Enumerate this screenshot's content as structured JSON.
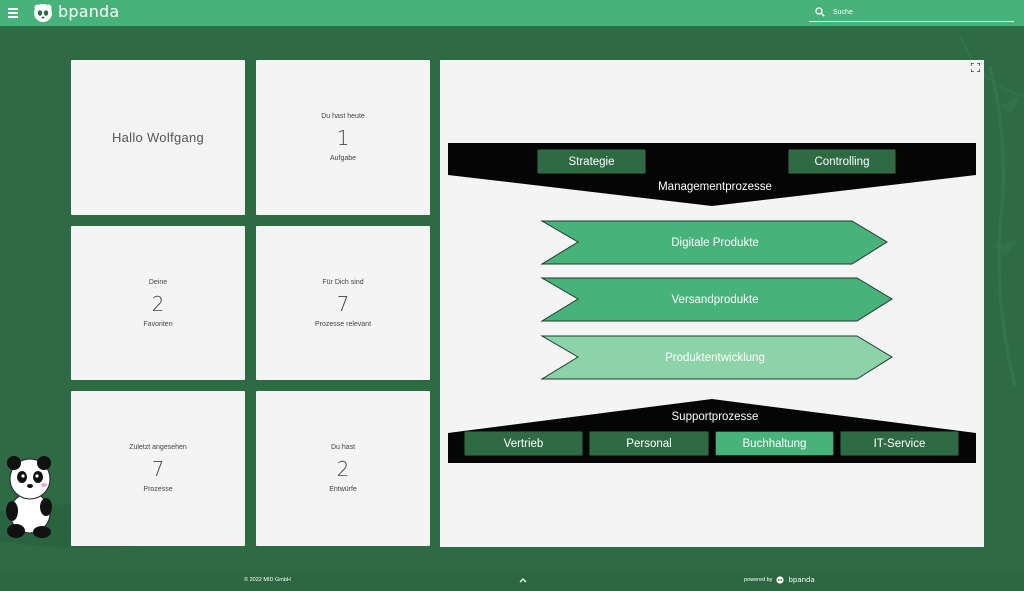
{
  "header": {
    "brand": "bpanda",
    "search_placeholder": "Suche"
  },
  "cards": {
    "greeting": "Hallo  Wolfgang",
    "tasks": {
      "top": "Du hast heute",
      "value": "1",
      "bottom": "Aufgabe"
    },
    "favorites": {
      "top": "Deine",
      "value": "2",
      "bottom": "Favoriten"
    },
    "relevant": {
      "top": "Für Dich sind",
      "value": "7",
      "bottom": "Prozesse relevant"
    },
    "recent": {
      "top": "Zuletzt angesehen",
      "value": "7",
      "bottom": "Prozesse"
    },
    "drafts": {
      "top": "Du hast",
      "value": "2",
      "bottom": "Entwürfe"
    }
  },
  "process_map": {
    "management_label": "Managementprozesse",
    "management": [
      "Strategie",
      "Controlling"
    ],
    "core": [
      "Digitale Produkte",
      "Versandprodukte",
      "Produktentwicklung"
    ],
    "support_label": "Supportprozesse",
    "support": [
      "Vertrieb",
      "Personal",
      "Buchhaltung",
      "IT-Service"
    ]
  },
  "footer": {
    "copyright": "© 2022 MID GmbH",
    "powered_by": "powered by",
    "brand": "bpanda"
  },
  "colors": {
    "header": "#47b37a",
    "background": "#2e6b45",
    "card": "#f4f4f4",
    "arrow_primary": "#47b37a",
    "arrow_light": "#8cd3aa",
    "black_band": "#050505"
  }
}
